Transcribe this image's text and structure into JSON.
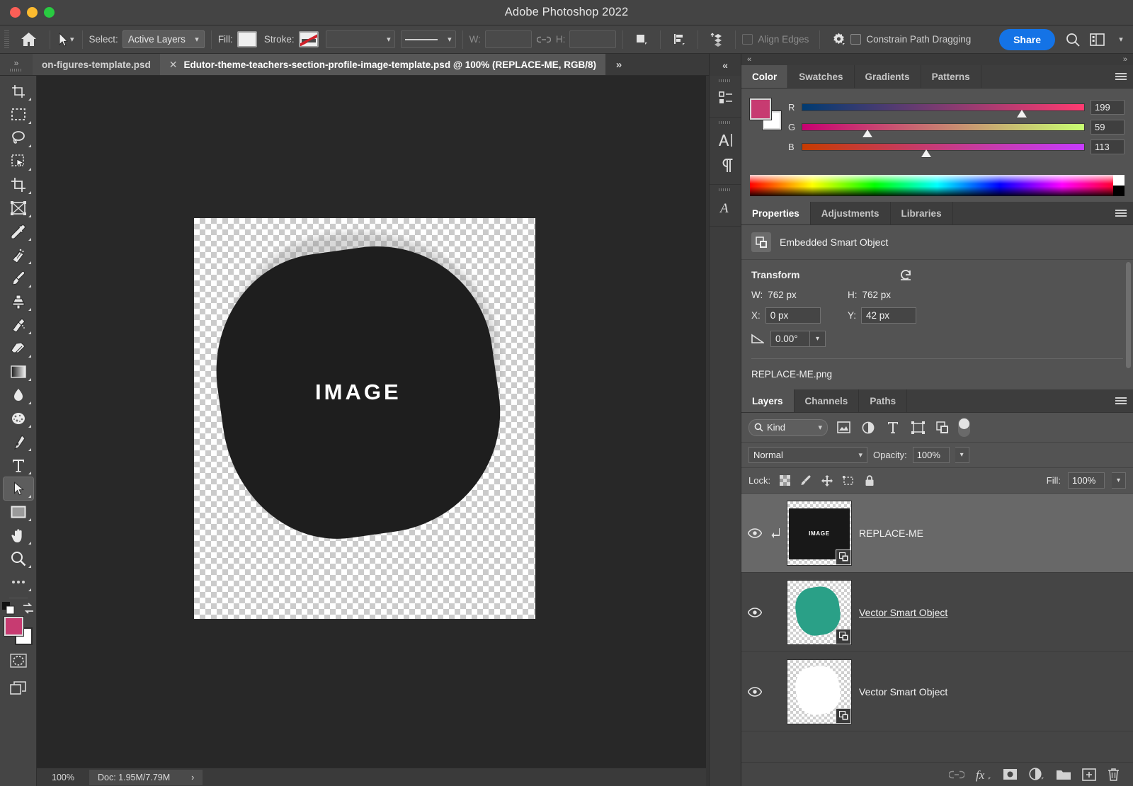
{
  "window": {
    "title": "Adobe Photoshop 2022",
    "controls": [
      "close",
      "minimize",
      "maximize"
    ]
  },
  "options_bar": {
    "home_icon": "home-icon",
    "move_tool_icon": "move-tool-icon",
    "select_label": "Select:",
    "select_value": "Active Layers",
    "fill_label": "Fill:",
    "stroke_label": "Stroke:",
    "stroke_value": "",
    "stroke_style_value": "",
    "w_label": "W:",
    "w_value": "",
    "link_icon": "link-icon",
    "h_label": "H:",
    "h_value": "",
    "path_ops_icon": "path-operations-icon",
    "align_icon": "path-alignment-icon",
    "arrange_icon": "path-arrangement-icon",
    "align_edges_label": "Align Edges",
    "gear_icon": "gear-icon",
    "constrain_label": "Constrain Path Dragging",
    "share_label": "Share",
    "search_icon": "search-icon",
    "workspace_icon": "workspace-icon",
    "chevron_icon": "chevron-down-icon"
  },
  "tabs": {
    "collapse_label": "»",
    "items": [
      {
        "label": "on-figures-template.psd",
        "active": false,
        "closable": false
      },
      {
        "label": "Edutor-theme-teachers-section-profile-image-template.psd @ 100% (REPLACE-ME, RGB/8)",
        "active": true,
        "closable": true
      }
    ],
    "overflow_label": "»"
  },
  "toolbar": {
    "tools": [
      {
        "name": "crop-frame-tool",
        "icon": "crop-frame-icon"
      },
      {
        "name": "marquee-tool",
        "icon": "rectangular-marquee-icon"
      },
      {
        "name": "lasso-tool",
        "icon": "lasso-icon"
      },
      {
        "name": "quick-selection-tool",
        "icon": "quick-selection-icon"
      },
      {
        "name": "crop-tool",
        "icon": "crop-icon"
      },
      {
        "name": "frame-tool",
        "icon": "frame-icon"
      },
      {
        "name": "eyedropper-tool",
        "icon": "eyedropper-icon"
      },
      {
        "name": "healing-brush-tool",
        "icon": "healing-brush-icon"
      },
      {
        "name": "brush-tool",
        "icon": "brush-icon"
      },
      {
        "name": "clone-stamp-tool",
        "icon": "clone-stamp-icon"
      },
      {
        "name": "history-brush-tool",
        "icon": "history-brush-icon"
      },
      {
        "name": "eraser-tool",
        "icon": "eraser-icon"
      },
      {
        "name": "gradient-tool",
        "icon": "gradient-icon"
      },
      {
        "name": "blur-tool",
        "icon": "blur-drop-icon"
      },
      {
        "name": "dodge-tool",
        "icon": "sponge-icon"
      },
      {
        "name": "pen-tool",
        "icon": "pen-icon"
      },
      {
        "name": "type-tool",
        "icon": "type-icon"
      },
      {
        "name": "path-selection-tool",
        "icon": "path-selection-arrow-icon",
        "active": true
      },
      {
        "name": "rectangle-tool",
        "icon": "rectangle-shape-icon"
      },
      {
        "name": "hand-tool",
        "icon": "hand-icon"
      },
      {
        "name": "zoom-tool",
        "icon": "magnifier-icon"
      },
      {
        "name": "edit-toolbar",
        "icon": "ellipsis-icon"
      }
    ],
    "foreground_color": "#c73b71",
    "background_color": "#ffffff",
    "swap_icon": "swap-colors-icon",
    "default_colors_icon": "default-colors-icon",
    "quick_mask_icon": "quick-mask-icon",
    "screen_mode_icon": "screen-mode-icon"
  },
  "canvas": {
    "artboard_label": "IMAGE",
    "blob_color": "#1e1e1e",
    "checker_color": "#cbcbcb"
  },
  "status_bar": {
    "zoom": "100%",
    "doc_info": "Doc: 1.95M/7.79M",
    "expand_icon": "chevron-right-icon"
  },
  "icon_dock": {
    "collapse_label": "«",
    "groups": [
      [
        {
          "name": "layer-comps-icon"
        }
      ],
      [
        {
          "name": "character-panel-icon"
        },
        {
          "name": "paragraph-panel-icon"
        }
      ],
      [
        {
          "name": "character-styles-icon"
        }
      ]
    ]
  },
  "color_panel": {
    "tabs": [
      {
        "label": "Color",
        "active": true
      },
      {
        "label": "Swatches",
        "active": false
      },
      {
        "label": "Gradients",
        "active": false
      },
      {
        "label": "Patterns",
        "active": false
      }
    ],
    "menu_icon": "panel-menu-icon",
    "foreground_hex": "#c73b71",
    "background_hex": "#ffffff",
    "channels": [
      {
        "letter": "R",
        "value": "199",
        "pct": 78
      },
      {
        "letter": "G",
        "value": "59",
        "pct": 23
      },
      {
        "letter": "B",
        "value": "113",
        "pct": 44
      }
    ]
  },
  "properties_panel": {
    "tabs": [
      {
        "label": "Properties",
        "active": true
      },
      {
        "label": "Adjustments",
        "active": false
      },
      {
        "label": "Libraries",
        "active": false
      }
    ],
    "menu_icon": "panel-menu-icon",
    "object_type": "Embedded Smart Object",
    "object_icon": "smart-object-icon",
    "transform": {
      "section_title": "Transform",
      "reset_icon": "reset-icon",
      "w_label": "W:",
      "w_value": "762 px",
      "h_label": "H:",
      "h_value": "762 px",
      "x_label": "X:",
      "x_value": "0 px",
      "y_label": "Y:",
      "y_value": "42 px",
      "angle_icon": "angle-icon",
      "angle_value": "0.00°"
    },
    "filename": "REPLACE-ME.png"
  },
  "layers_panel": {
    "tabs": [
      {
        "label": "Layers",
        "active": true
      },
      {
        "label": "Channels",
        "active": false
      },
      {
        "label": "Paths",
        "active": false
      }
    ],
    "menu_icon": "panel-menu-icon",
    "filter": {
      "kind_label": "Kind",
      "search_icon": "search-icon",
      "chevron_icon": "chevron-down-icon",
      "filter_icons": [
        "pixel-layer-filter-icon",
        "adjustment-layer-filter-icon",
        "type-layer-filter-icon",
        "shape-layer-filter-icon",
        "smart-object-filter-icon"
      ],
      "toggle_icon": "filter-toggle-switch"
    },
    "blend_mode": "Normal",
    "opacity_label": "Opacity:",
    "opacity_value": "100%",
    "lock_label": "Lock:",
    "lock_icons": [
      "lock-transparency-icon",
      "lock-image-icon",
      "lock-position-icon",
      "lock-artboard-icon",
      "lock-all-icon"
    ],
    "fill_label": "Fill:",
    "fill_value": "100%",
    "layers": [
      {
        "name": "REPLACE-ME",
        "selected": true,
        "clipped": true,
        "visible": true,
        "thumb_type": "image-placeholder",
        "thumb_label": "IMAGE",
        "thumb_color": "#181818",
        "smart_object": true,
        "underlined": false
      },
      {
        "name": "Vector Smart Object",
        "selected": false,
        "clipped": false,
        "visible": true,
        "thumb_type": "blob",
        "thumb_color": "#2aa087",
        "smart_object": true,
        "underlined": true
      },
      {
        "name": "Vector Smart Object",
        "selected": false,
        "clipped": false,
        "visible": true,
        "thumb_type": "blob",
        "thumb_color": "#ffffff",
        "smart_object": true,
        "underlined": false
      }
    ],
    "footer_icons": [
      "link-layers-icon",
      "layer-style-fx-icon",
      "layer-mask-icon",
      "adjustment-layer-icon",
      "new-group-icon",
      "new-layer-icon",
      "delete-layer-icon"
    ]
  }
}
